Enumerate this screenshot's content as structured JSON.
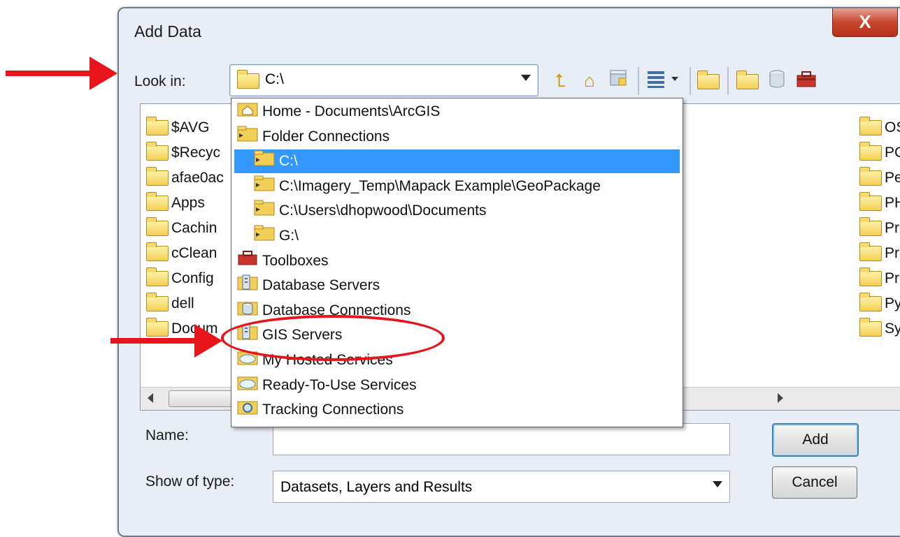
{
  "window": {
    "title": "Add Data",
    "close_glyph": "X"
  },
  "lookin": {
    "label": "Look in:",
    "value": "C:\\"
  },
  "toolbar": {
    "icons": [
      "up-one-level-icon",
      "home-icon",
      "connect-to-folder-icon",
      "view-options-icon",
      "new-folder-icon",
      "catalog-folder-icon",
      "database-icon",
      "toolbox-icon"
    ]
  },
  "files_left": [
    "$AVG",
    "$Recyc",
    "afae0ac",
    "Apps",
    "Cachin",
    "cClean",
    "Config",
    "dell",
    "Docum"
  ],
  "files_right": [
    "OSC",
    "PCI",
    "Perf",
    "PHF",
    "Pro",
    "Pro",
    "Pro",
    "Pyth",
    "Syst"
  ],
  "dropdown": {
    "items": [
      {
        "label": "Home - Documents\\ArcGIS",
        "icon": "home-folder-icon",
        "indent": 0
      },
      {
        "label": "Folder Connections",
        "icon": "folder-connections-icon",
        "indent": 0
      },
      {
        "label": "C:\\",
        "icon": "folder-connection-icon",
        "indent": 1,
        "selected": true
      },
      {
        "label": "C:\\Imagery_Temp\\Mapack Example\\GeoPackage",
        "icon": "folder-connection-icon",
        "indent": 1
      },
      {
        "label": "C:\\Users\\dhopwood\\Documents",
        "icon": "folder-connection-icon",
        "indent": 1
      },
      {
        "label": "G:\\",
        "icon": "folder-connection-icon",
        "indent": 1
      },
      {
        "label": "Toolboxes",
        "icon": "toolbox-icon",
        "indent": 0
      },
      {
        "label": "Database Servers",
        "icon": "database-servers-icon",
        "indent": 0
      },
      {
        "label": "Database Connections",
        "icon": "database-connections-icon",
        "indent": 0
      },
      {
        "label": "GIS Servers",
        "icon": "gis-servers-icon",
        "indent": 0
      },
      {
        "label": "My Hosted Services",
        "icon": "hosted-services-icon",
        "indent": 0
      },
      {
        "label": "Ready-To-Use Services",
        "icon": "ready-to-use-services-icon",
        "indent": 0
      },
      {
        "label": "Tracking Connections",
        "icon": "tracking-connections-icon",
        "indent": 0
      }
    ]
  },
  "name": {
    "label": "Name:",
    "value": ""
  },
  "show_type": {
    "label": "Show of type:",
    "value": "Datasets, Layers and Results"
  },
  "buttons": {
    "add": "Add",
    "cancel": "Cancel"
  },
  "colors": {
    "annotation_red": "#e8141b",
    "selection_blue": "#3399ff"
  }
}
